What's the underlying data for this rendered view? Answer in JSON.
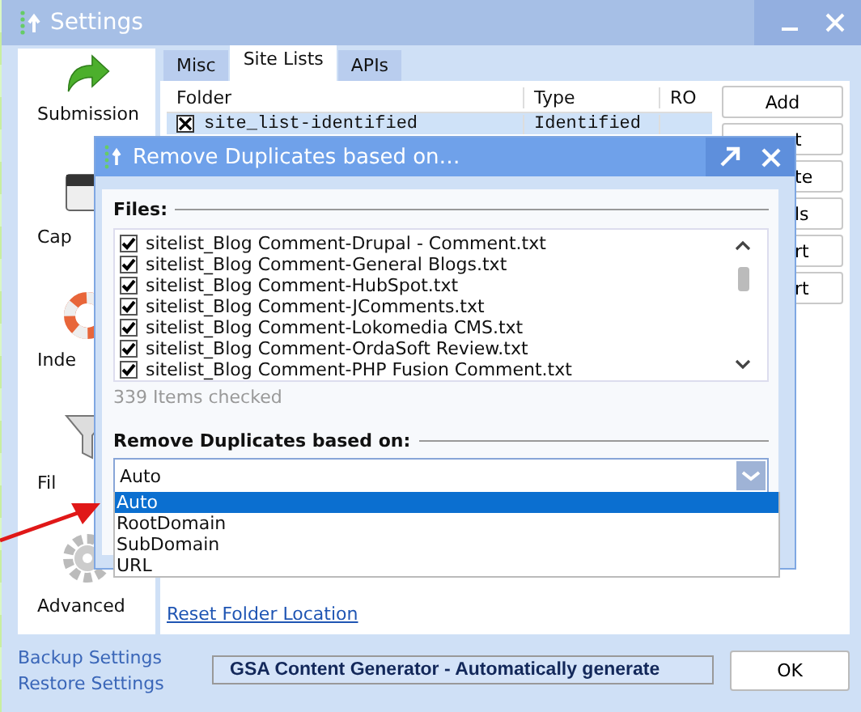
{
  "window": {
    "title": "Settings"
  },
  "nav": [
    {
      "label": "Submission",
      "kind": "arrow"
    },
    {
      "label": "Cap",
      "kind": "captcha"
    },
    {
      "label": "Inde",
      "kind": "lifebuoy"
    },
    {
      "label": "Fil",
      "kind": "funnel"
    },
    {
      "label": "Advanced",
      "kind": "gear"
    }
  ],
  "tabs": [
    {
      "label": "Misc",
      "selected": false
    },
    {
      "label": "Site Lists",
      "selected": true
    },
    {
      "label": "APIs",
      "selected": false
    }
  ],
  "table": {
    "columns": [
      "Folder",
      "Type",
      "RO"
    ],
    "rows": [
      {
        "folder": "site_list-identified",
        "type": "Identified",
        "checked": true,
        "selected": true
      }
    ]
  },
  "side_buttons": [
    "Add",
    "t",
    "te",
    "ls",
    "rt",
    "rt"
  ],
  "reset_link": "Reset Folder Location",
  "footer": {
    "links": [
      "Backup Settings",
      "Restore Settings"
    ],
    "status": "GSA Content Generator - Automatically generate",
    "ok": "OK"
  },
  "dialog": {
    "title": "Remove Duplicates based on…",
    "files_label": "Files:",
    "files": [
      {
        "name": "sitelist_Blog Comment-Drupal - Comment.txt",
        "checked": true
      },
      {
        "name": "sitelist_Blog Comment-General Blogs.txt",
        "checked": true
      },
      {
        "name": "sitelist_Blog Comment-HubSpot.txt",
        "checked": true
      },
      {
        "name": "sitelist_Blog Comment-JComments.txt",
        "checked": true
      },
      {
        "name": "sitelist_Blog Comment-Lokomedia CMS.txt",
        "checked": true
      },
      {
        "name": "sitelist_Blog Comment-OrdaSoft Review.txt",
        "checked": true
      },
      {
        "name": "sitelist_Blog Comment-PHP Fusion Comment.txt",
        "checked": true
      }
    ],
    "count": "339 Items checked",
    "mode_label": "Remove Duplicates based on:",
    "combo_value": "Auto",
    "options": [
      {
        "label": "Auto",
        "selected": true
      },
      {
        "label": "RootDomain",
        "selected": false
      },
      {
        "label": "SubDomain",
        "selected": false
      },
      {
        "label": "URL",
        "selected": false
      }
    ]
  }
}
